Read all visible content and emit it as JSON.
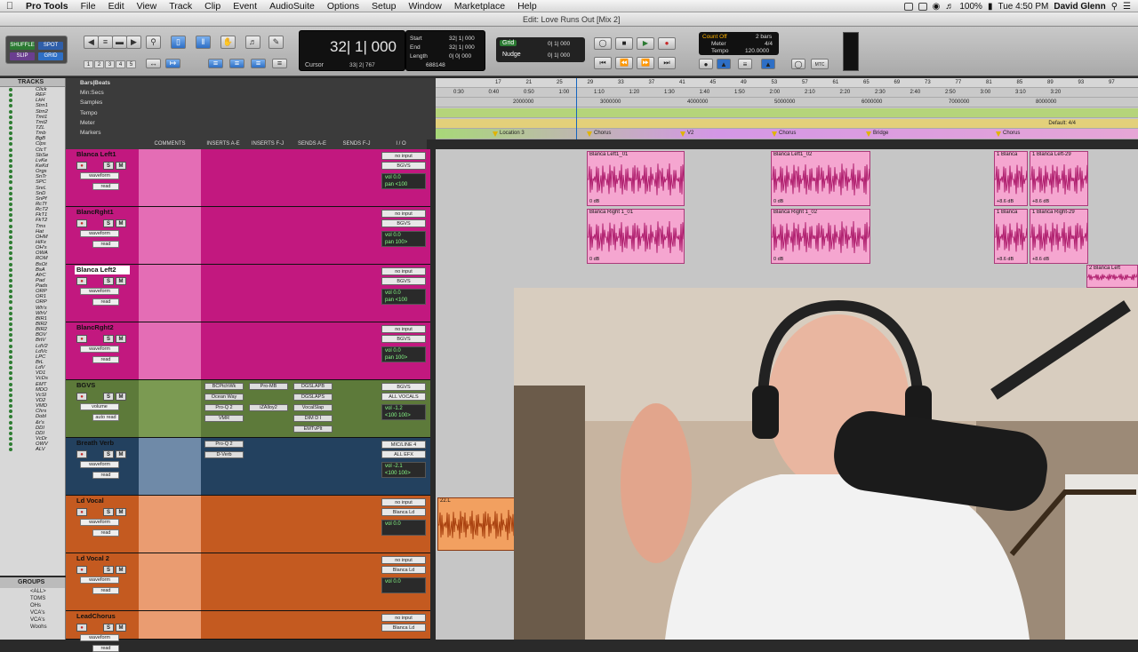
{
  "menubar": {
    "apple": "",
    "app": "Pro Tools",
    "items": [
      "File",
      "Edit",
      "View",
      "Track",
      "Clip",
      "Event",
      "AudioSuite",
      "Options",
      "Setup",
      "Window",
      "Marketplace",
      "Help"
    ],
    "window_title": "Edit: Love Runs Out [Mix 2]",
    "battery": "100%",
    "clock": "Tue 4:50 PM",
    "user": "David Glenn"
  },
  "toolbar": {
    "modes": [
      "SHUFFLE",
      "SPOT",
      "SLIP",
      "GRID"
    ],
    "numbers": [
      "1",
      "2",
      "3",
      "4",
      "5"
    ],
    "counter_main": "32| 1| 000",
    "cursor_label": "Cursor",
    "cursor_value": "33| 2| 767",
    "cursor_extra": "688148",
    "sel_labels": [
      "Start",
      "End",
      "Length"
    ],
    "sel_values": [
      "32| 1| 000",
      "32| 1| 000",
      "0| 0| 000"
    ],
    "grid_label": "Grid",
    "grid_value": "0| 1| 000",
    "nudge_label": "Nudge",
    "nudge_value": "0| 1| 000",
    "countoff": "Count Off",
    "countoff_val": "2 bars",
    "meter": "Meter",
    "meter_val": "4/4",
    "tempo": "Tempo",
    "tempo_val": "120.0000"
  },
  "tracks_panel": {
    "header": "TRACKS",
    "items": [
      "Click",
      "REF",
      "LkH",
      "Strn1",
      "Strn2",
      "Tmt1",
      "Tmt2",
      "TZL",
      "Tmb",
      "BgB",
      "Clps",
      "CtcT",
      "SbSe",
      "LvKe",
      "KeKd",
      "Orgs",
      "SnTr",
      "SPC",
      "SnrL",
      "SnD",
      "SnPf",
      "RcTf",
      "RcT2",
      "FkT1",
      "FkT2",
      "Tms",
      "Hat",
      "OHM",
      "HiFx",
      "OH's",
      "OWA",
      "ROM",
      "BsOt",
      "BsA",
      "AfrC",
      "Pad",
      "Pads",
      "ORP",
      "OR1",
      "ORP",
      "Wh's",
      "WhV",
      "BIR1",
      "BIR2",
      "BIR2",
      "BOV",
      "BrtV",
      "LdV2",
      "LdVc",
      "LPC",
      "BrL",
      "LdV",
      "VD1",
      "VcDs",
      "EMT",
      "MDO",
      "VcSl",
      "VD2",
      "VMD",
      "Chrs",
      "Dobl",
      "&r's",
      "DDI",
      "DDI",
      "VcDr",
      "OWV",
      "ALV"
    ],
    "groups_header": "GROUPS",
    "groups": [
      "<ALL>",
      "TOMS",
      "OHs",
      "VCA's",
      "VCA's",
      "Woohs"
    ]
  },
  "columns": [
    "COMMENTS",
    "INSERTS A-E",
    "INSERTS F-J",
    "SENDS A-E",
    "SENDS F-J",
    "I / O"
  ],
  "tracks": [
    {
      "name": "Blanca Left1",
      "view": "waveform",
      "mode": "read",
      "io_in": "no input",
      "io_out": "BGVS",
      "vol": "vol  0.0",
      "pan": "pan  <100"
    },
    {
      "name": "BlancRght1",
      "view": "waveform",
      "mode": "read",
      "io_in": "no input",
      "io_out": "BGVS",
      "vol": "vol  0.0",
      "pan": "pan  100>"
    },
    {
      "name": "Blanca Left2",
      "view": "waveform",
      "mode": "read",
      "io_in": "no input",
      "io_out": "BGVS",
      "vol": "vol  0.0",
      "pan": "pan  <100"
    },
    {
      "name": "BlancRght2",
      "view": "waveform",
      "mode": "read",
      "io_in": "no input",
      "io_out": "BGVS",
      "vol": "vol  0.0",
      "pan": "pan  100>"
    },
    {
      "name": "BGVS",
      "view": "volume",
      "mode": "auto read",
      "io_in": "BGVS",
      "io_out": "ALL VOCALS",
      "vol": "vol  -1.2",
      "pan": "<100  100>",
      "inserts_a": [
        "BCPtchWk",
        "Ocean Way",
        "Pro-Q 2",
        "VMR"
      ],
      "inserts_b": [
        "Pro-MB",
        "",
        "iZAlloy2",
        ""
      ],
      "sends_a": [
        "DGSLAPB",
        "DGSLAPS",
        "VocalSlap",
        "DIM D I",
        "EMTvPlt"
      ]
    },
    {
      "name": "Breath Verb",
      "view": "waveform",
      "mode": "read",
      "io_in": "MIC/LINE 4",
      "io_out": "ALL EFX",
      "vol": "vol  -2.1",
      "pan": "<100  100>",
      "inserts_a": [
        "Pro-Q 2",
        "D-Verb"
      ]
    },
    {
      "name": "Ld Vocal",
      "view": "waveform",
      "mode": "read",
      "io_in": "no input",
      "io_out": "Blanca Ld",
      "vol": "vol  0.0",
      "pan": ""
    },
    {
      "name": "Ld Vocal 2",
      "view": "waveform",
      "mode": "read",
      "io_in": "no input",
      "io_out": "Blanca Ld",
      "vol": "vol  0.0",
      "pan": ""
    },
    {
      "name": "LeadChorus",
      "view": "waveform",
      "mode": "read",
      "io_in": "no input",
      "io_out": "Blanca Ld",
      "vol": "",
      "pan": ""
    }
  ],
  "ruler": {
    "labels": [
      "Bars|Beats",
      "Min:Secs",
      "Samples",
      "Tempo",
      "Meter",
      "Markers"
    ],
    "bars": [
      "17",
      "21",
      "25",
      "29",
      "33",
      "37",
      "41",
      "45",
      "49",
      "53",
      "57",
      "61",
      "65",
      "69",
      "73",
      "77",
      "81",
      "85",
      "89",
      "93",
      "97",
      "101"
    ],
    "mins": [
      "0:30",
      "0:40",
      "0:50",
      "1:00",
      "1:10",
      "1:20",
      "1:30",
      "1:40",
      "1:50",
      "2:00",
      "2:10",
      "2:20",
      "2:30",
      "2:40",
      "2:50",
      "3:00",
      "3:10",
      "3:20"
    ],
    "samples": [
      "2000000",
      "3000000",
      "4000000",
      "5000000",
      "6000000",
      "7000000",
      "8000000"
    ],
    "meter_default": "Default: 4/4",
    "markers": [
      "Location 3",
      "Chorus",
      "V2",
      "Chorus",
      "Bridge",
      "Chorus"
    ]
  },
  "clips": {
    "row1": [
      "Blanca Left1_01",
      "Blanca Left1_02",
      "1 Blanca",
      "1 Blanca Left-29"
    ],
    "row2": [
      "Blanca Right 1_01",
      "Blanca Right 1_02",
      "1 Blanca",
      "1 Blanca Right-29"
    ],
    "row3": [
      "2 Blanca Left"
    ],
    "db": [
      "0 dB",
      "0 dB",
      "+8.6 dB",
      "+8.6 dB"
    ],
    "vocal": "22.L"
  },
  "colors": {
    "pink_track": "#c2187f",
    "green_track": "#5d7a3a",
    "blue_track": "#23415f",
    "orange_track": "#c45a20",
    "clip_pink": "#f5a6d0"
  }
}
